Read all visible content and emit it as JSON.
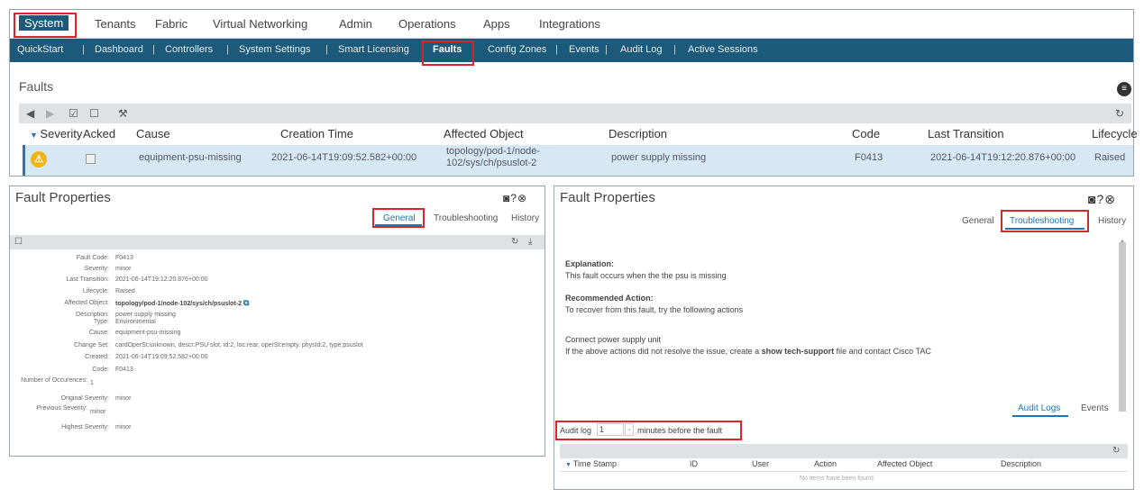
{
  "main_nav": [
    "System",
    "Tenants",
    "Fabric",
    "Virtual Networking",
    "Admin",
    "Operations",
    "Apps",
    "Integrations"
  ],
  "sub_nav": [
    "QuickStart",
    "Dashboard",
    "Controllers",
    "System Settings",
    "Smart Licensing",
    "Faults",
    "Config Zones",
    "Events",
    "Audit Log",
    "Active Sessions"
  ],
  "faults": {
    "title": "Faults",
    "columns": [
      "Severity",
      "Acked",
      "Cause",
      "Creation Time",
      "Affected Object",
      "Description",
      "Code",
      "Last Transition",
      "Lifecycle"
    ],
    "row": {
      "cause": "equipment-psu-missing",
      "creation_time": "2021-06-14T19:09:52.582+00:00",
      "affected_object_1": "topology/pod-1/node-",
      "affected_object_2": "102/sys/ch/psuslot-2",
      "description": "power supply missing",
      "code": "F0413",
      "last_transition": "2021-06-14T19:12:20.876+00:00",
      "lifecycle": "Raised"
    }
  },
  "left_props": {
    "title": "Fault Properties",
    "tabs": [
      "General",
      "Troubleshooting",
      "History"
    ],
    "fields": [
      {
        "label": "Fault Code:",
        "value": "F0413"
      },
      {
        "label": "Severity:",
        "value": "minor"
      },
      {
        "label": "Last Transition:",
        "value": "2021-06-14T19:12:20.876+00:00"
      },
      {
        "label": "Lifecycle:",
        "value": "Raised"
      },
      {
        "label": "Affected Object:",
        "value": "topology/pod-1/node-102/sys/ch/psuslot-2"
      },
      {
        "label": "Description:",
        "value": "power supply missing"
      },
      {
        "label": "Type:",
        "value": "Environmental"
      },
      {
        "label": "Cause:",
        "value": "equipment-psu-missing"
      },
      {
        "label": "Change Set:",
        "value": "cardOperSt:unknown, descr:PSU slot, id:2, loc:rear, operSt:empty, physId:2, type:psuslot"
      },
      {
        "label": "Created:",
        "value": "2021-06-14T19:09:52.582+00:00"
      },
      {
        "label": "Code:",
        "value": "F0413"
      },
      {
        "label": "Number of Occurences:",
        "value": "1"
      },
      {
        "label": "Original Severity:",
        "value": "minor"
      },
      {
        "label": "Previous Severity:",
        "value": "minor"
      },
      {
        "label": "Highest Severity:",
        "value": "minor"
      }
    ]
  },
  "right_props": {
    "title": "Fault Properties",
    "tabs": [
      "General",
      "Troubleshooting",
      "History"
    ],
    "explanation_label": "Explanation:",
    "explanation_text": "This fault occurs when the the psu is missing",
    "recommended_label": "Recommended Action:",
    "recommended_text": "To recover from this fault, try the following actions",
    "step1": "Connect power supply unit",
    "step2_pre": "If the above actions did not resolve the issue, create a ",
    "step2_bold": "show tech-support",
    "step2_post": " file and contact Cisco TAC",
    "sub_tabs": [
      "Audit Logs",
      "Events"
    ],
    "audit_log_label": "Audit log",
    "audit_log_value": "1",
    "audit_log_suffix": "minutes before the fault",
    "columns": [
      "Time Stamp",
      "ID",
      "User",
      "Action",
      "Affected Object",
      "Description"
    ],
    "empty_text": "No items have been found."
  },
  "colors": {
    "accent": "#1f74b9",
    "subnav": "#1b5a7a",
    "highlight": "#d9262b",
    "warning": "#f2b319"
  }
}
